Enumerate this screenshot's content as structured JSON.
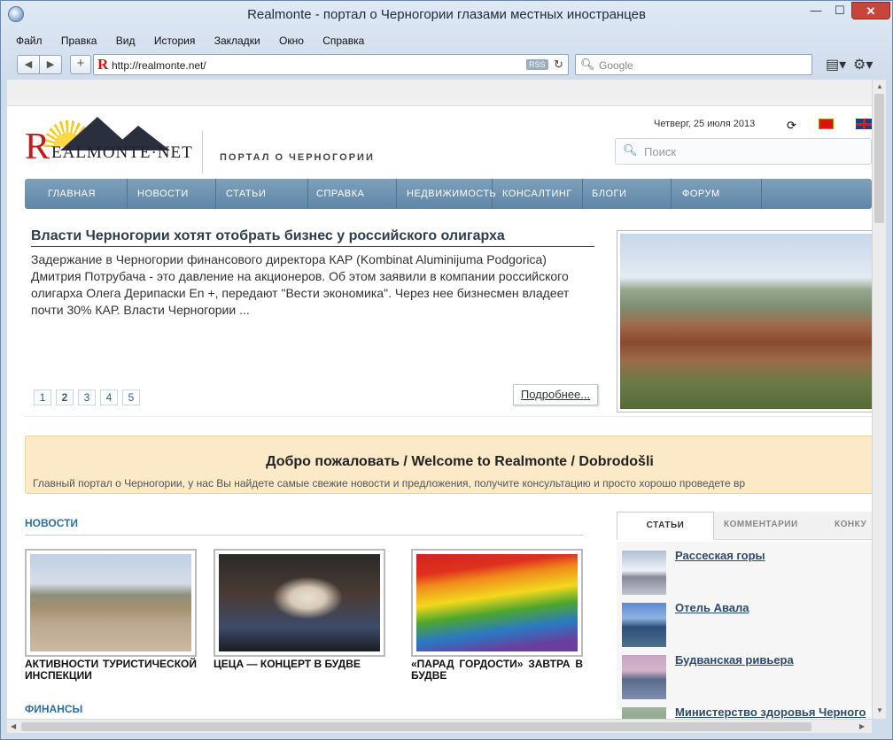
{
  "window": {
    "title": "Realmonte - портал о Черногории глазами местных иностранцев",
    "min": "—",
    "max": "☐",
    "close": "✕"
  },
  "menu": [
    "Файл",
    "Правка",
    "Вид",
    "История",
    "Закладки",
    "Окно",
    "Справка"
  ],
  "toolbar": {
    "back": "◀",
    "forward": "▶",
    "add": "+",
    "url": "http://realmonte.net/",
    "rss": "RSS",
    "reload": "↻",
    "search_placeholder": "Google",
    "page_menu": "▤▾",
    "settings": "⚙▾"
  },
  "site": {
    "logo_r": "R",
    "logo_text": "EALMONTE·NET",
    "tagline": "ПОРТАЛ О ЧЕРНОГОРИИ",
    "date": "Четверг, 25 июля 2013",
    "search_placeholder": "Поиск",
    "nav": [
      "ГЛАВНАЯ",
      "НОВОСТИ",
      "СТАТЬИ",
      "СПРАВКА",
      "НЕДВИЖИМОСТЬ",
      "КОНСАЛТИНГ",
      "БЛОГИ",
      "ФОРУМ"
    ]
  },
  "featured": {
    "title": "Власти Черногории хотят отобрать бизнес у российского олигарха",
    "text": "Задержание в Черногории финансового директора КАР (Kombinat Aluminijuma Podgorica) Дмитрия Потрубача - это давление на акционеров. Об этом заявили в компании российского олигарха Олега Дерипаски Еn +, передают \"Вести экономика\". Через нее бизнесмен владеет почти 30% КАР. Власти Черногории ...",
    "pages": [
      "1",
      "2",
      "3",
      "4",
      "5"
    ],
    "active_page": "2",
    "more": "Подробнее..."
  },
  "welcome": {
    "title": "Добро пожаловать / Welcome to Realmonte / Dobrodošli",
    "text": "Главный портал о Черногории, у нас Вы найдете самые свежие новости и предложения, получите консультацию и просто хорошо проведете вр"
  },
  "news": {
    "heading": "НОВОСТИ",
    "items": [
      {
        "title": "АКТИВНОСТИ ТУРИСТИЧЕСКОЙ ИНСПЕКЦИИ"
      },
      {
        "title": "ЦЕЦА — КОНЦЕРТ В БУДВЕ"
      },
      {
        "title": "«ПАРАД ГОРДОСТИ» ЗАВТРА В БУДВЕ"
      }
    ]
  },
  "finance": {
    "heading": "ФИНАНСЫ"
  },
  "sidebar": {
    "tabs": [
      "СТАТЬИ",
      "КОММЕНТАРИИ",
      "КОНКУ"
    ],
    "items": [
      {
        "title": "Рассеская горы"
      },
      {
        "title": "Отель Авала"
      },
      {
        "title": "Будванская ривьера"
      },
      {
        "title": "Министерство здоровья Черного"
      }
    ]
  }
}
